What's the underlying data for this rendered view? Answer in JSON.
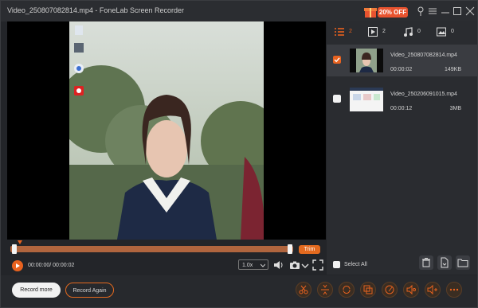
{
  "window": {
    "title": "Video_250807082814.mp4 - FoneLab Screen Recorder"
  },
  "promo": {
    "label": "20% OFF"
  },
  "tabs": [
    {
      "icon": "list-icon",
      "count": "2"
    },
    {
      "icon": "play-icon",
      "count": "2"
    },
    {
      "icon": "music-icon",
      "count": "0"
    },
    {
      "icon": "image-icon",
      "count": "0"
    }
  ],
  "files": [
    {
      "name": "Video_250807082814.mp4",
      "duration": "00:00:02",
      "size": "149KB",
      "checked": true
    },
    {
      "name": "Video_250206091015.mp4",
      "duration": "00:00:12",
      "size": "3MB",
      "checked": false
    }
  ],
  "panel": {
    "select_all": "Select All"
  },
  "player": {
    "time": "00:00:00/ 00:00:02",
    "speed": "1.0x",
    "trim": "Trim"
  },
  "bottom": {
    "record_more": "Record more",
    "record_again": "Record Again"
  },
  "colors": {
    "accent": "#e8621f"
  }
}
